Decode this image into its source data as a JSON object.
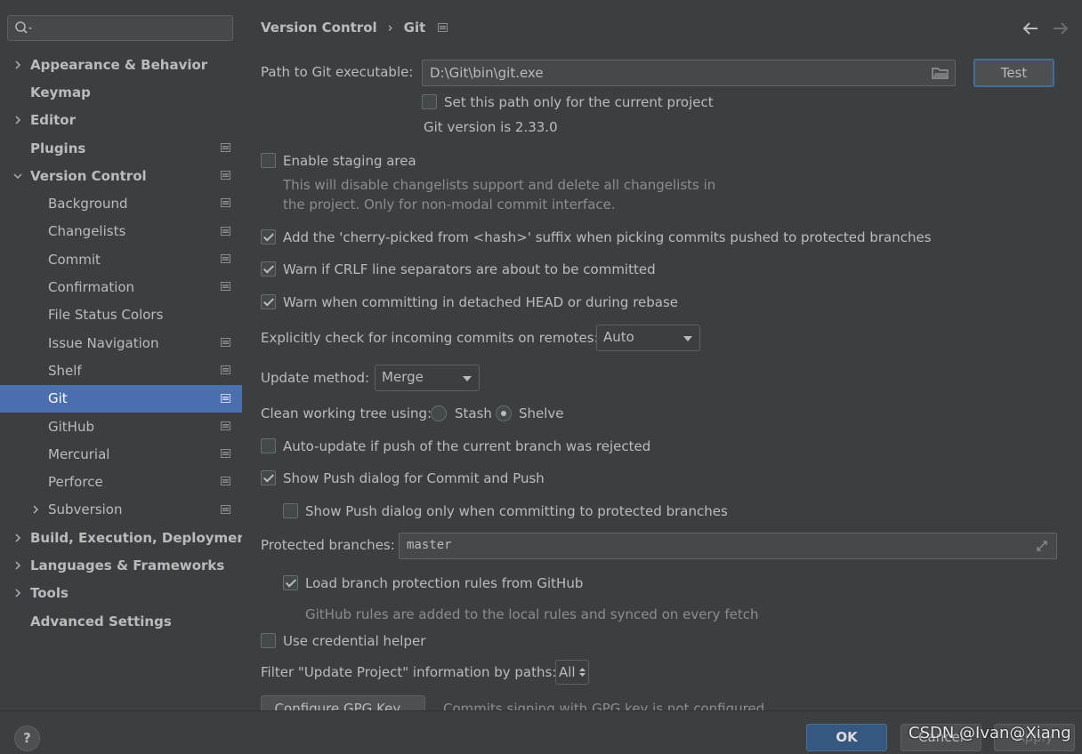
{
  "search": {
    "placeholder": "",
    "value": ""
  },
  "sidebar": {
    "items": [
      {
        "label": "Appearance & Behavior",
        "level": 0,
        "expandable": true,
        "expanded": false,
        "project": false
      },
      {
        "label": "Keymap",
        "level": 0,
        "expandable": false,
        "project": false
      },
      {
        "label": "Editor",
        "level": 0,
        "expandable": true,
        "expanded": false,
        "project": false
      },
      {
        "label": "Plugins",
        "level": 0,
        "expandable": false,
        "project": true
      },
      {
        "label": "Version Control",
        "level": 0,
        "expandable": true,
        "expanded": true,
        "project": true
      },
      {
        "label": "Background",
        "level": 1,
        "expandable": false,
        "project": true
      },
      {
        "label": "Changelists",
        "level": 1,
        "expandable": false,
        "project": true
      },
      {
        "label": "Commit",
        "level": 1,
        "expandable": false,
        "project": true
      },
      {
        "label": "Confirmation",
        "level": 1,
        "expandable": false,
        "project": true
      },
      {
        "label": "File Status Colors",
        "level": 1,
        "expandable": false,
        "project": false
      },
      {
        "label": "Issue Navigation",
        "level": 1,
        "expandable": false,
        "project": true
      },
      {
        "label": "Shelf",
        "level": 1,
        "expandable": false,
        "project": true
      },
      {
        "label": "Git",
        "level": 1,
        "expandable": false,
        "project": true,
        "selected": true
      },
      {
        "label": "GitHub",
        "level": 1,
        "expandable": false,
        "project": true
      },
      {
        "label": "Mercurial",
        "level": 1,
        "expandable": false,
        "project": true
      },
      {
        "label": "Perforce",
        "level": 1,
        "expandable": false,
        "project": true
      },
      {
        "label": "Subversion",
        "level": 1,
        "expandable": true,
        "expanded": false,
        "project": true
      },
      {
        "label": "Build, Execution, Deployment",
        "level": 0,
        "expandable": true,
        "expanded": false,
        "project": false
      },
      {
        "label": "Languages & Frameworks",
        "level": 0,
        "expandable": true,
        "expanded": false,
        "project": false
      },
      {
        "label": "Tools",
        "level": 0,
        "expandable": true,
        "expanded": false,
        "project": false
      },
      {
        "label": "Advanced Settings",
        "level": 0,
        "expandable": false,
        "project": false
      }
    ]
  },
  "header": {
    "breadcrumb_parent": "Version Control",
    "breadcrumb_separator": "›",
    "breadcrumb_current": "Git"
  },
  "git": {
    "path_label": "Path to Git executable:",
    "path_value": "D:\\Git\\bin\\git.exe",
    "test_label": "Test",
    "current_project_only_label": "Set this path only for the current project",
    "current_project_only_checked": false,
    "version_text": "Git version is 2.33.0",
    "staging_label": "Enable staging area",
    "staging_checked": false,
    "staging_hint_line1": "This will disable changelists support and delete all changelists in",
    "staging_hint_line2": "the project. Only for non-modal commit interface.",
    "cherry_pick_label": "Add the 'cherry-picked from <hash>' suffix when picking commits pushed to protected branches",
    "cherry_pick_checked": true,
    "crlf_label": "Warn if CRLF line separators are about to be committed",
    "crlf_checked": true,
    "detached_label": "Warn when committing in detached HEAD or during rebase",
    "detached_checked": true,
    "incoming_label": "Explicitly check for incoming commits on remotes:",
    "incoming_value": "Auto",
    "update_method_label": "Update method:",
    "update_method_value": "Merge",
    "clean_tree_label": "Clean working tree using:",
    "stash_label": "Stash",
    "shelve_label": "Shelve",
    "clean_tree_selected": "Shelve",
    "auto_update_label": "Auto-update if push of the current branch was rejected",
    "auto_update_checked": false,
    "show_push_label": "Show Push dialog for Commit and Push",
    "show_push_checked": true,
    "show_push_protected_label": "Show Push dialog only when committing to protected branches",
    "show_push_protected_checked": false,
    "protected_branches_label": "Protected branches:",
    "protected_branches_value": "master",
    "load_rules_label": "Load branch protection rules from GitHub",
    "load_rules_checked": true,
    "github_rules_hint": "GitHub rules are added to the local rules and synced on every fetch",
    "credential_helper_label": "Use credential helper",
    "credential_helper_checked": false,
    "filter_label": "Filter \"Update Project\" information by paths:",
    "filter_value": "All",
    "gpg_button_label": "Configure GPG Key...",
    "gpg_hint": "Commits signing with GPG key is not configured"
  },
  "footer": {
    "help_label": "?",
    "ok_label": "OK",
    "cancel_label": "Cancel",
    "apply_label": "Apply",
    "watermark": "CSDN @Ivan@Xiang"
  },
  "colors": {
    "background": "#3c3f41",
    "selection": "#4b6eaf",
    "ok_button": "#365880",
    "text": "#bbbbbb"
  }
}
